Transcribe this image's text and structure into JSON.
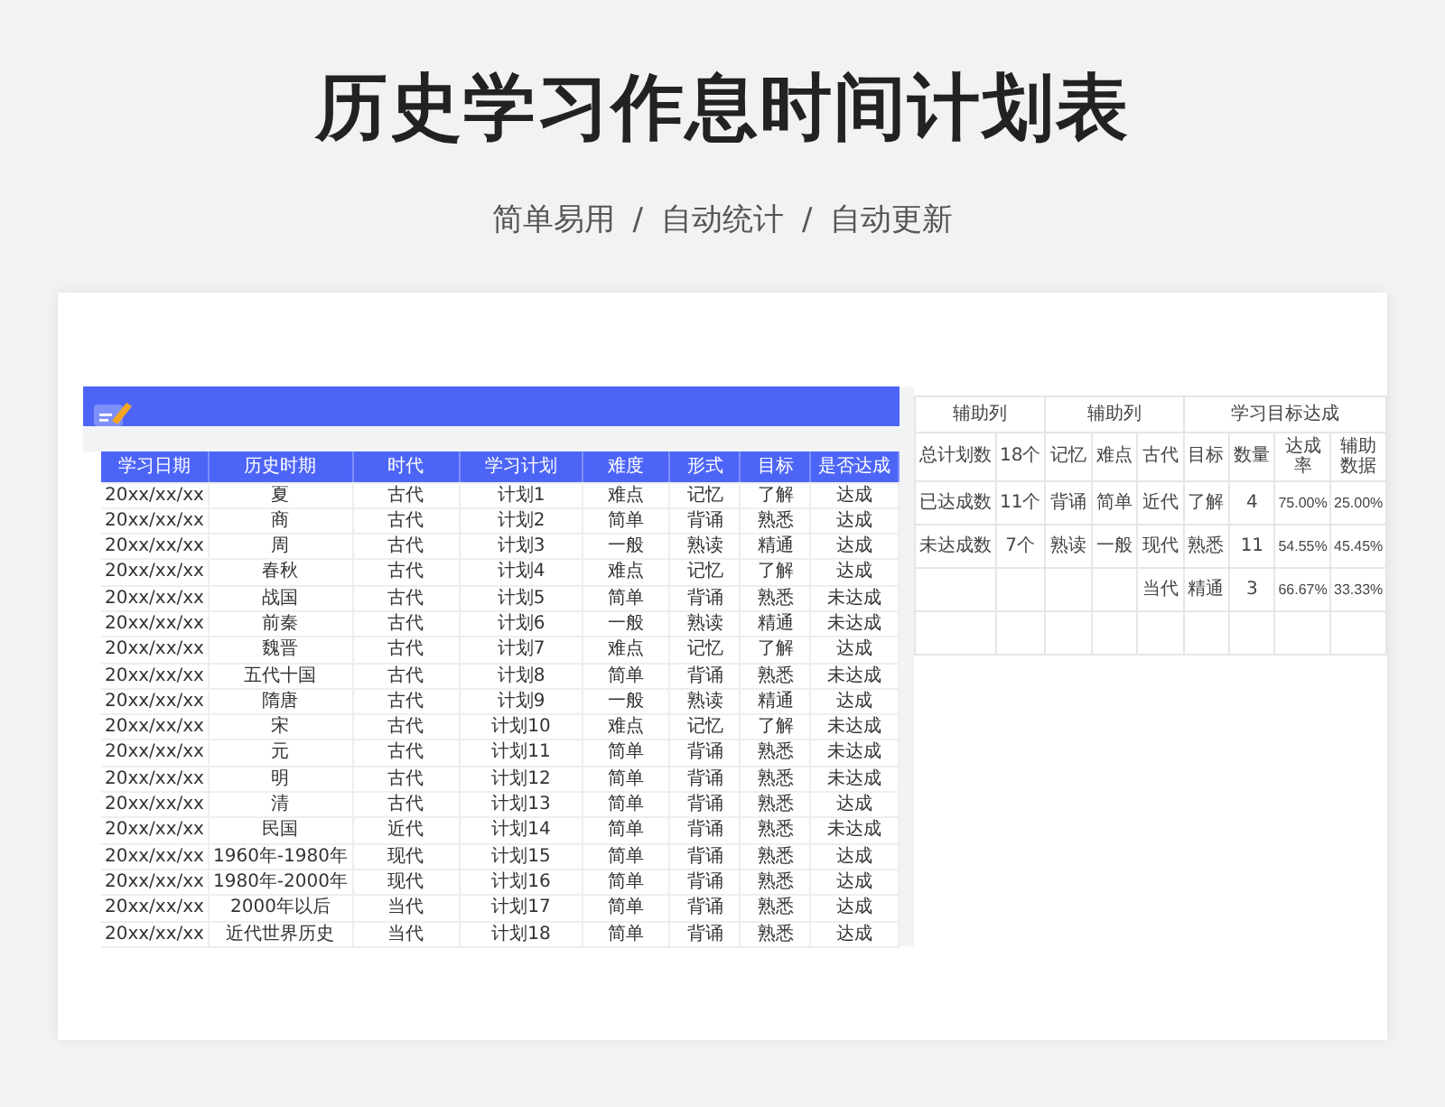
{
  "title": "历史学习作息时间计划表",
  "subtitle": [
    "简单易用",
    "/",
    "自动统计",
    "/",
    "自动更新"
  ],
  "plan_table": {
    "columns": [
      "学习日期",
      "历史时期",
      "时代",
      "学习计划",
      "难度",
      "形式",
      "目标",
      "是否达成"
    ],
    "rows": [
      [
        "20xx/xx/xx",
        "夏",
        "古代",
        "计划1",
        "难点",
        "记忆",
        "了解",
        "达成"
      ],
      [
        "20xx/xx/xx",
        "商",
        "古代",
        "计划2",
        "简单",
        "背诵",
        "熟悉",
        "达成"
      ],
      [
        "20xx/xx/xx",
        "周",
        "古代",
        "计划3",
        "一般",
        "熟读",
        "精通",
        "达成"
      ],
      [
        "20xx/xx/xx",
        "春秋",
        "古代",
        "计划4",
        "难点",
        "记忆",
        "了解",
        "达成"
      ],
      [
        "20xx/xx/xx",
        "战国",
        "古代",
        "计划5",
        "简单",
        "背诵",
        "熟悉",
        "未达成"
      ],
      [
        "20xx/xx/xx",
        "前秦",
        "古代",
        "计划6",
        "一般",
        "熟读",
        "精通",
        "未达成"
      ],
      [
        "20xx/xx/xx",
        "魏晋",
        "古代",
        "计划7",
        "难点",
        "记忆",
        "了解",
        "达成"
      ],
      [
        "20xx/xx/xx",
        "五代十国",
        "古代",
        "计划8",
        "简单",
        "背诵",
        "熟悉",
        "未达成"
      ],
      [
        "20xx/xx/xx",
        "隋唐",
        "古代",
        "计划9",
        "一般",
        "熟读",
        "精通",
        "达成"
      ],
      [
        "20xx/xx/xx",
        "宋",
        "古代",
        "计划10",
        "难点",
        "记忆",
        "了解",
        "未达成"
      ],
      [
        "20xx/xx/xx",
        "元",
        "古代",
        "计划11",
        "简单",
        "背诵",
        "熟悉",
        "未达成"
      ],
      [
        "20xx/xx/xx",
        "明",
        "古代",
        "计划12",
        "简单",
        "背诵",
        "熟悉",
        "未达成"
      ],
      [
        "20xx/xx/xx",
        "清",
        "古代",
        "计划13",
        "简单",
        "背诵",
        "熟悉",
        "达成"
      ],
      [
        "20xx/xx/xx",
        "民国",
        "近代",
        "计划14",
        "简单",
        "背诵",
        "熟悉",
        "未达成"
      ],
      [
        "20xx/xx/xx",
        "1960年-1980年",
        "现代",
        "计划15",
        "简单",
        "背诵",
        "熟悉",
        "达成"
      ],
      [
        "20xx/xx/xx",
        "1980年-2000年",
        "现代",
        "计划16",
        "简单",
        "背诵",
        "熟悉",
        "达成"
      ],
      [
        "20xx/xx/xx",
        "2000年以后",
        "当代",
        "计划17",
        "简单",
        "背诵",
        "熟悉",
        "达成"
      ],
      [
        "20xx/xx/xx",
        "近代世界历史",
        "当代",
        "计划18",
        "简单",
        "背诵",
        "熟悉",
        "达成"
      ]
    ]
  },
  "stats_table": {
    "header_groups": [
      "辅助列",
      "辅助列",
      "学习目标达成"
    ],
    "rows": [
      [
        "总计划数",
        "18个",
        "记忆",
        "难点",
        "古代",
        "目标",
        "数量",
        "达成率",
        "辅助数据"
      ],
      [
        "已达成数",
        "11个",
        "背诵",
        "简单",
        "近代",
        "了解",
        "4",
        "75.00%",
        "25.00%"
      ],
      [
        "未达成数",
        "7个",
        "熟读",
        "一般",
        "现代",
        "熟悉",
        "11",
        "54.55%",
        "45.45%"
      ],
      [
        null,
        null,
        null,
        null,
        "当代",
        "精通",
        "3",
        "66.67%",
        "33.33%"
      ]
    ]
  }
}
